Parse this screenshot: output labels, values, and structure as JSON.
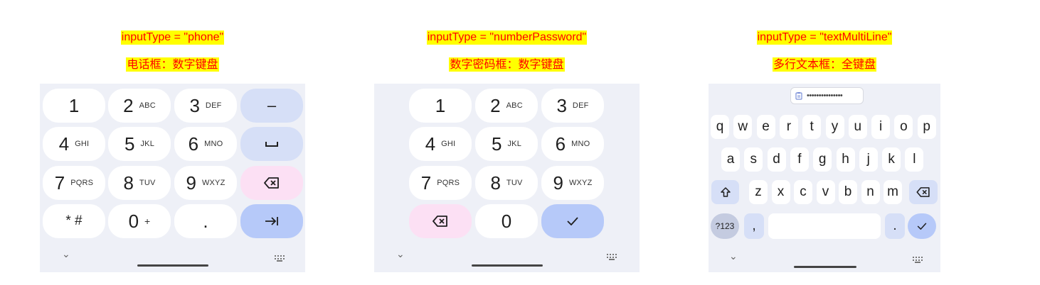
{
  "panels": [
    {
      "caption_line1": "inputType = \"phone\"",
      "caption_line2": "电话框：数字键盘",
      "rows": [
        [
          {
            "digit": "1",
            "sub": ""
          },
          {
            "digit": "2",
            "sub": "ABC"
          },
          {
            "digit": "3",
            "sub": "DEF"
          }
        ],
        [
          {
            "digit": "4",
            "sub": "GHI"
          },
          {
            "digit": "5",
            "sub": "JKL"
          },
          {
            "digit": "6",
            "sub": "MNO"
          }
        ],
        [
          {
            "digit": "7",
            "sub": "PQRS"
          },
          {
            "digit": "8",
            "sub": "TUV"
          },
          {
            "digit": "9",
            "sub": "WXYZ"
          }
        ],
        [
          {
            "digit": "* #",
            "sub": ""
          },
          {
            "digit": "0",
            "sub": "+"
          },
          {
            "digit": ".",
            "sub": ""
          }
        ]
      ],
      "side_keys": [
        "–",
        "space-icon",
        "backspace-icon",
        "tab-icon"
      ]
    },
    {
      "caption_line1": "inputType = \"numberPassword\"",
      "caption_line2": "数字密码框：数字键盘",
      "rows": [
        [
          {
            "digit": "1",
            "sub": ""
          },
          {
            "digit": "2",
            "sub": "ABC"
          },
          {
            "digit": "3",
            "sub": "DEF"
          }
        ],
        [
          {
            "digit": "4",
            "sub": "GHI"
          },
          {
            "digit": "5",
            "sub": "JKL"
          },
          {
            "digit": "6",
            "sub": "MNO"
          }
        ],
        [
          {
            "digit": "7",
            "sub": "PQRS"
          },
          {
            "digit": "8",
            "sub": "TUV"
          },
          {
            "digit": "9",
            "sub": "WXYZ"
          }
        ],
        [
          {
            "digit": "backspace-icon",
            "sub": ""
          },
          {
            "digit": "0",
            "sub": ""
          },
          {
            "digit": "check-icon",
            "sub": ""
          }
        ]
      ]
    },
    {
      "caption_line1": "inputType = \"textMultiLine\"",
      "caption_line2": "多行文本框：全键盘",
      "clipboard_text": "•••••••••••••••",
      "row1": [
        "q",
        "w",
        "e",
        "r",
        "t",
        "y",
        "u",
        "i",
        "o",
        "p"
      ],
      "row2": [
        "a",
        "s",
        "d",
        "f",
        "g",
        "h",
        "j",
        "k",
        "l"
      ],
      "row3": [
        "z",
        "x",
        "c",
        "v",
        "b",
        "n",
        "m"
      ],
      "symbols_label": "?123",
      "comma": ",",
      "period": "."
    }
  ],
  "colors": {
    "caption_bg": "#ffff00",
    "caption_text": "#ff0000",
    "keyboard_bg": "#eef0f7",
    "key_bg": "#ffffff",
    "func_key_bg": "#d6dff7",
    "delete_key_bg": "#fce0f4",
    "action_key_bg": "#b6c9f9"
  }
}
